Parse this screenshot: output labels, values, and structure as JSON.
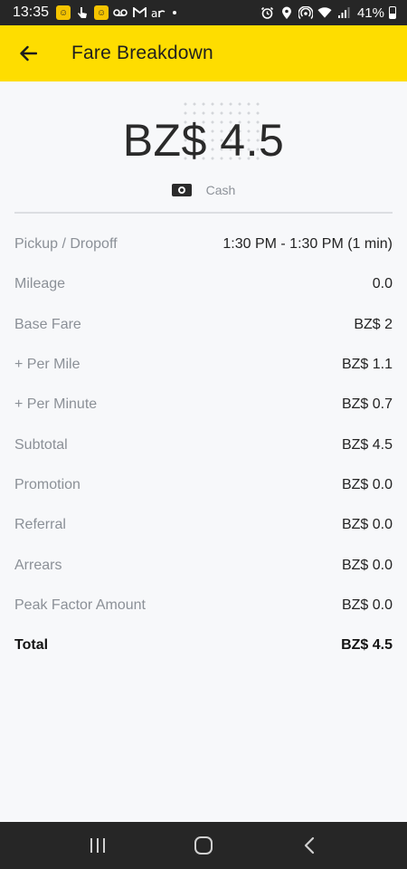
{
  "status_bar": {
    "time": "13:35",
    "battery_text": "41%",
    "left_icons": [
      "app-notification-icon",
      "touch-icon",
      "app-notification-icon",
      "voicemail-icon",
      "gmail-icon",
      "airtel-icon",
      "dot-icon"
    ],
    "right_icons": [
      "alarm-icon",
      "location-icon",
      "hotspot-icon",
      "wifi-icon",
      "signal-icon",
      "battery-icon"
    ]
  },
  "app_bar": {
    "title": "Fare Breakdown",
    "back_icon": "arrow-left-icon",
    "background_color": "#fedd00"
  },
  "summary": {
    "amount": "BZ$ 4.5",
    "payment_method": "Cash",
    "payment_icon": "cash-icon"
  },
  "fare_rows": [
    {
      "label": "Pickup / Dropoff",
      "value": "1:30 PM - 1:30 PM (1 min)"
    },
    {
      "label": "Mileage",
      "value": "0.0"
    },
    {
      "label": "Base Fare",
      "value": "BZ$ 2"
    },
    {
      "label": "+ Per Mile",
      "value": "BZ$ 1.1"
    },
    {
      "label": "+ Per Minute",
      "value": "BZ$ 0.7"
    },
    {
      "label": "Subtotal",
      "value": "BZ$ 4.5"
    },
    {
      "label": "Promotion",
      "value": "BZ$ 0.0"
    },
    {
      "label": "Referral",
      "value": "BZ$ 0.0"
    },
    {
      "label": "Arrears",
      "value": "BZ$ 0.0"
    },
    {
      "label": "Peak Factor Amount",
      "value": "BZ$ 0.0"
    },
    {
      "label": "Total",
      "value": "BZ$ 4.5"
    }
  ],
  "nav_bar": {
    "icons": [
      "recent-apps-icon",
      "home-icon",
      "back-icon"
    ]
  }
}
